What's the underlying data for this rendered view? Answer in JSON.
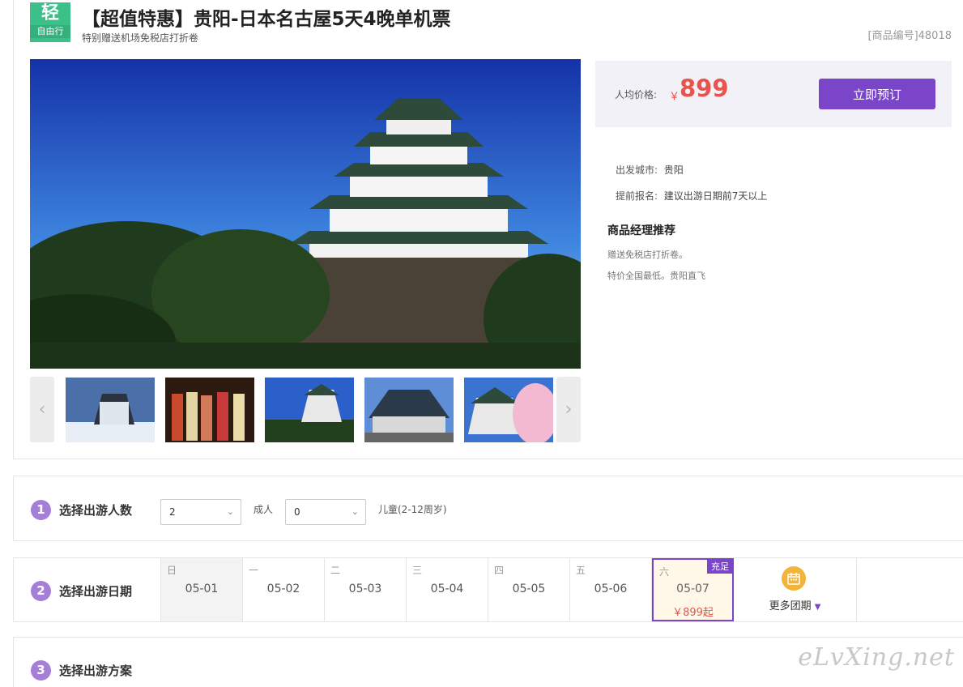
{
  "header": {
    "badge_main": "轻",
    "badge_sub": "自由行",
    "title": "【超值特惠】贵阳-日本名古屋5天4晚单机票",
    "subtitle": "特别赠送机场免税店打折卷",
    "product_no": "[商品编号]48018"
  },
  "price": {
    "label": "人均价格:",
    "currency": "￥",
    "amount": "899",
    "book_button": "立即预订"
  },
  "info": {
    "depart_key": "出发城市:",
    "depart_val": "贵阳",
    "signup_key": "提前报名:",
    "signup_val": "建议出游日期前7天以上"
  },
  "manager": {
    "title": "商品经理推荐",
    "lines": [
      "赠送免税店打折卷。",
      "特价全国最低。贵阳直飞"
    ]
  },
  "gallery": {
    "prev": "‹",
    "next": "›"
  },
  "step1": {
    "num": "1",
    "title": "选择出游人数",
    "adult_value": "2",
    "adult_label": "成人",
    "child_value": "0",
    "child_label": "儿童(2-12周岁)"
  },
  "step2": {
    "num": "2",
    "title": "选择出游日期",
    "days": [
      {
        "wk": "日",
        "date": "05-01"
      },
      {
        "wk": "一",
        "date": "05-02"
      },
      {
        "wk": "二",
        "date": "05-03"
      },
      {
        "wk": "三",
        "date": "05-04"
      },
      {
        "wk": "四",
        "date": "05-05"
      },
      {
        "wk": "五",
        "date": "05-06"
      },
      {
        "wk": "六",
        "date": "05-07",
        "price": "￥899起",
        "tag": "充足"
      }
    ],
    "more": "更多团期",
    "more_arrow": "▼"
  },
  "step3": {
    "num": "3",
    "title": "选择出游方案"
  },
  "watermark": "eLvXing.net",
  "colors": {
    "accent": "#7b45c9",
    "price": "#e8544d",
    "badge": "#3cc08a"
  }
}
